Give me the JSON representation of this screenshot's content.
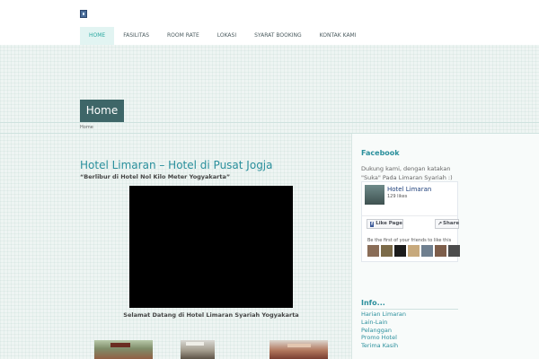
{
  "nav": {
    "items": [
      "HOME",
      "FASILITAS",
      "ROOM RATE",
      "LOKASI",
      "SYARAT BOOKING",
      "KONTAK KAMI"
    ]
  },
  "page": {
    "title_bar": "Home",
    "breadcrumb": "Home",
    "main_title": "Hotel Limaran – Hotel di Pusat Jogja",
    "subtitle": "“Berlibur di Hotel Nol Kilo Meter Yogyakarta”",
    "video_caption": "Selamat Datang di Hotel Limaran Syariah Yogyakarta"
  },
  "sidebar": {
    "facebook": {
      "heading": "Facebook",
      "text": "Dukung kami, dengan katakan \"Suka\" Pada Limaran Syariah :)",
      "page_name": "Hotel Limaran",
      "likes": "129 likes",
      "like_button": "Like Page",
      "share_button": "Share",
      "first_text": "Be the first of your friends to like this"
    },
    "info": {
      "heading": "Info...",
      "links": [
        "Harian Limaran",
        "Lain-Lain",
        "Pelanggan",
        "Promo Hotel",
        "Terima Kasih"
      ]
    }
  },
  "colors": {
    "accent": "#2aa8a0",
    "title_bar": "#3e6668",
    "link": "#2a8f9c",
    "facebook_blue": "#3b5998",
    "friend_avatars": [
      "#8a6d57",
      "#7b6a48",
      "#1c1c1c",
      "#c7a97c",
      "#6f7f8f",
      "#7d5d4a",
      "#4c4c4c"
    ]
  },
  "icons": {
    "logo": "site-logo-icon",
    "facebook": "facebook-f-icon",
    "share": "share-arrow-icon"
  }
}
